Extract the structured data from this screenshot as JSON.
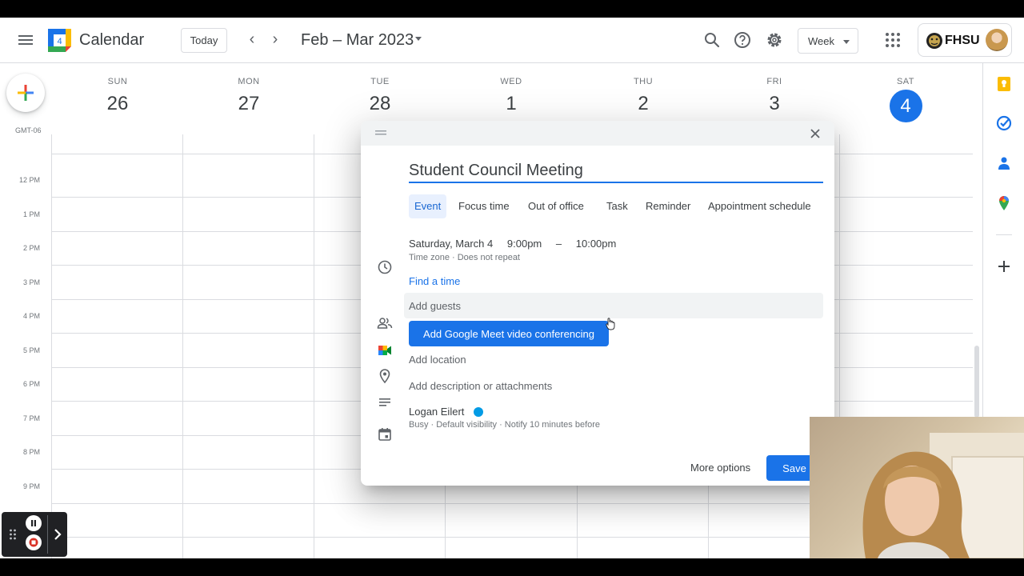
{
  "topbar": {
    "logo_day": "4",
    "app_title": "Calendar",
    "today_label": "Today",
    "prev_arrow": "‹",
    "next_arrow": "›",
    "date_range": "Feb – Mar 2023",
    "view_select": "Week",
    "account_org": "FHSU"
  },
  "calendar": {
    "timezone": "GMT-06",
    "days": [
      {
        "name": "SUN",
        "num": "26"
      },
      {
        "name": "MON",
        "num": "27"
      },
      {
        "name": "TUE",
        "num": "28"
      },
      {
        "name": "WED",
        "num": "1"
      },
      {
        "name": "THU",
        "num": "2"
      },
      {
        "name": "FRI",
        "num": "3"
      },
      {
        "name": "SAT",
        "num": "4"
      }
    ],
    "hours": [
      "12 PM",
      "1 PM",
      "2 PM",
      "3 PM",
      "4 PM",
      "5 PM",
      "6 PM",
      "7 PM",
      "8 PM",
      "9 PM"
    ]
  },
  "dialog": {
    "title_value": "Student Council Meeting",
    "tabs": [
      "Event",
      "Focus time",
      "Out of office",
      "Task",
      "Reminder",
      "Appointment schedule"
    ],
    "date": "Saturday, March 4",
    "start_time": "9:00pm",
    "dash": "–",
    "end_time": "10:00pm",
    "tz_line": "Time zone · Does not repeat",
    "find_time": "Find a time",
    "guests_placeholder": "Add guests",
    "meet_button": "Add Google Meet video conferencing",
    "location_placeholder": "Add location",
    "description_placeholder": "Add description or attachments",
    "owner": "Logan Eilert",
    "owner_meta": "Busy · Default visibility · Notify 10 minutes before",
    "more_options": "More options",
    "save": "Save"
  },
  "colors": {
    "accent": "#1a73e8",
    "owner_calendar": "#039be5"
  }
}
